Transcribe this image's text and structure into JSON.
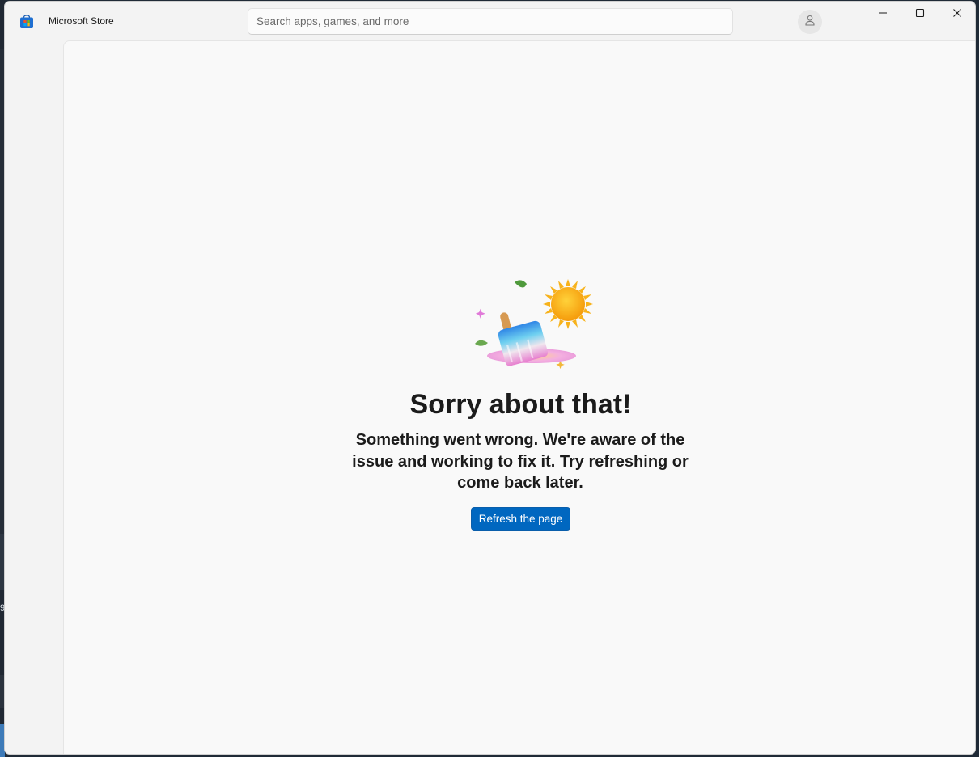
{
  "app": {
    "title": "Microsoft Store",
    "icon": "microsoft-store-icon"
  },
  "search": {
    "placeholder": "Search apps, games, and more",
    "value": ""
  },
  "account": {
    "icon": "person-icon"
  },
  "window_controls": {
    "minimize_icon": "minimize-icon",
    "maximize_icon": "maximize-icon",
    "close_icon": "close-icon"
  },
  "error": {
    "illustration": "melting-popsicle-illustration",
    "title": "Sorry about that!",
    "message": "Something went wrong. We're aware of the issue and working to fix it. Try refreshing or come back later.",
    "refresh_label": "Refresh the page"
  },
  "desktop": {
    "edge_glyph": "9"
  },
  "colors": {
    "accent": "#0067c0",
    "content_bg": "#f9f9f9",
    "chrome_bg": "#f3f3f3",
    "text": "#1b1b1b"
  }
}
